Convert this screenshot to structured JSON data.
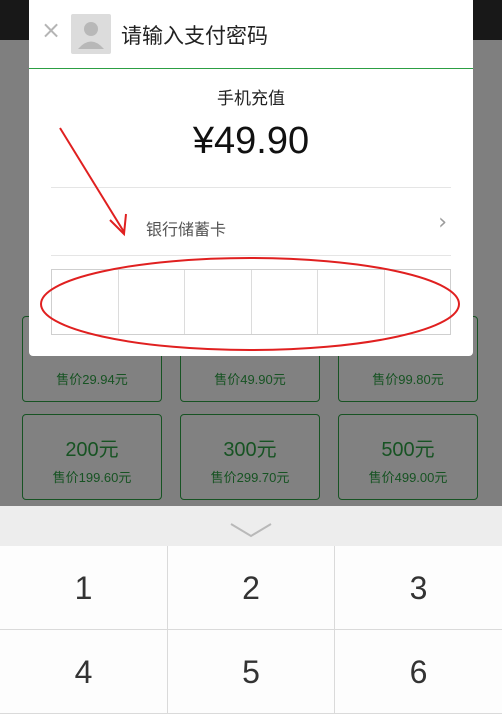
{
  "dialog": {
    "title": "请输入支付密码",
    "item": "手机充值",
    "amount": "¥49.90",
    "payment_method": "银行储蓄卡"
  },
  "background": {
    "cards": [
      {
        "value": "",
        "price": "售价29.94元"
      },
      {
        "value": "",
        "price": "售价49.90元"
      },
      {
        "value": "",
        "price": "售价99.80元"
      },
      {
        "value": "200元",
        "price": "售价199.60元"
      },
      {
        "value": "300元",
        "price": "售价299.70元"
      },
      {
        "value": "500元",
        "price": "售价499.00元"
      }
    ]
  },
  "keyboard": {
    "keys": [
      "1",
      "2",
      "3",
      "4",
      "5",
      "6"
    ]
  },
  "colors": {
    "accent": "#2c9f43",
    "annotation": "#e02020"
  }
}
